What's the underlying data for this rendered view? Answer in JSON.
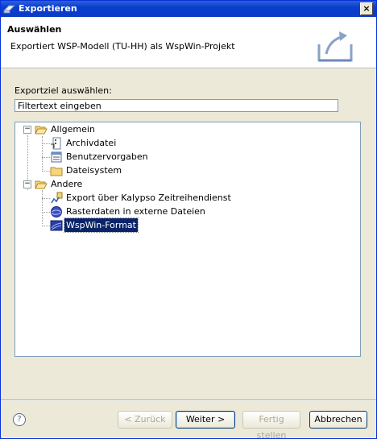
{
  "window": {
    "title": "Exportieren",
    "close_glyph": "×"
  },
  "header": {
    "title": "Auswählen",
    "description": "Exportiert WSP-Modell (TU-HH) als WspWin-Projekt",
    "banner_icon": "export-wizard-icon"
  },
  "filter": {
    "label": "Exportziel auswählen:",
    "value": "Filtertext eingeben"
  },
  "tree": {
    "categories": [
      {
        "label": "Allgemein",
        "icon": "open-folder-icon",
        "items": [
          {
            "label": "Archivdatei",
            "icon": "archive-file-icon"
          },
          {
            "label": "Benutzervorgaben",
            "icon": "preferences-icon"
          },
          {
            "label": "Dateisystem",
            "icon": "folder-icon"
          }
        ]
      },
      {
        "label": "Andere",
        "icon": "open-folder-icon",
        "items": [
          {
            "label": "Export über Kalypso Zeitreihendienst",
            "icon": "timeseries-export-icon"
          },
          {
            "label": "Rasterdaten in externe Dateien",
            "icon": "raster-data-icon"
          },
          {
            "label": "WspWin-Format",
            "icon": "wspwin-icon",
            "selected": true
          }
        ]
      }
    ]
  },
  "buttons": {
    "help": "?",
    "back": "< Zurück",
    "next": "Weiter >",
    "finish": "Fertig stellen",
    "cancel": "Abbrechen"
  },
  "colors": {
    "titlebar": "#0a3ecf",
    "selection": "#0a246a",
    "dialog": "#ece9d8"
  }
}
